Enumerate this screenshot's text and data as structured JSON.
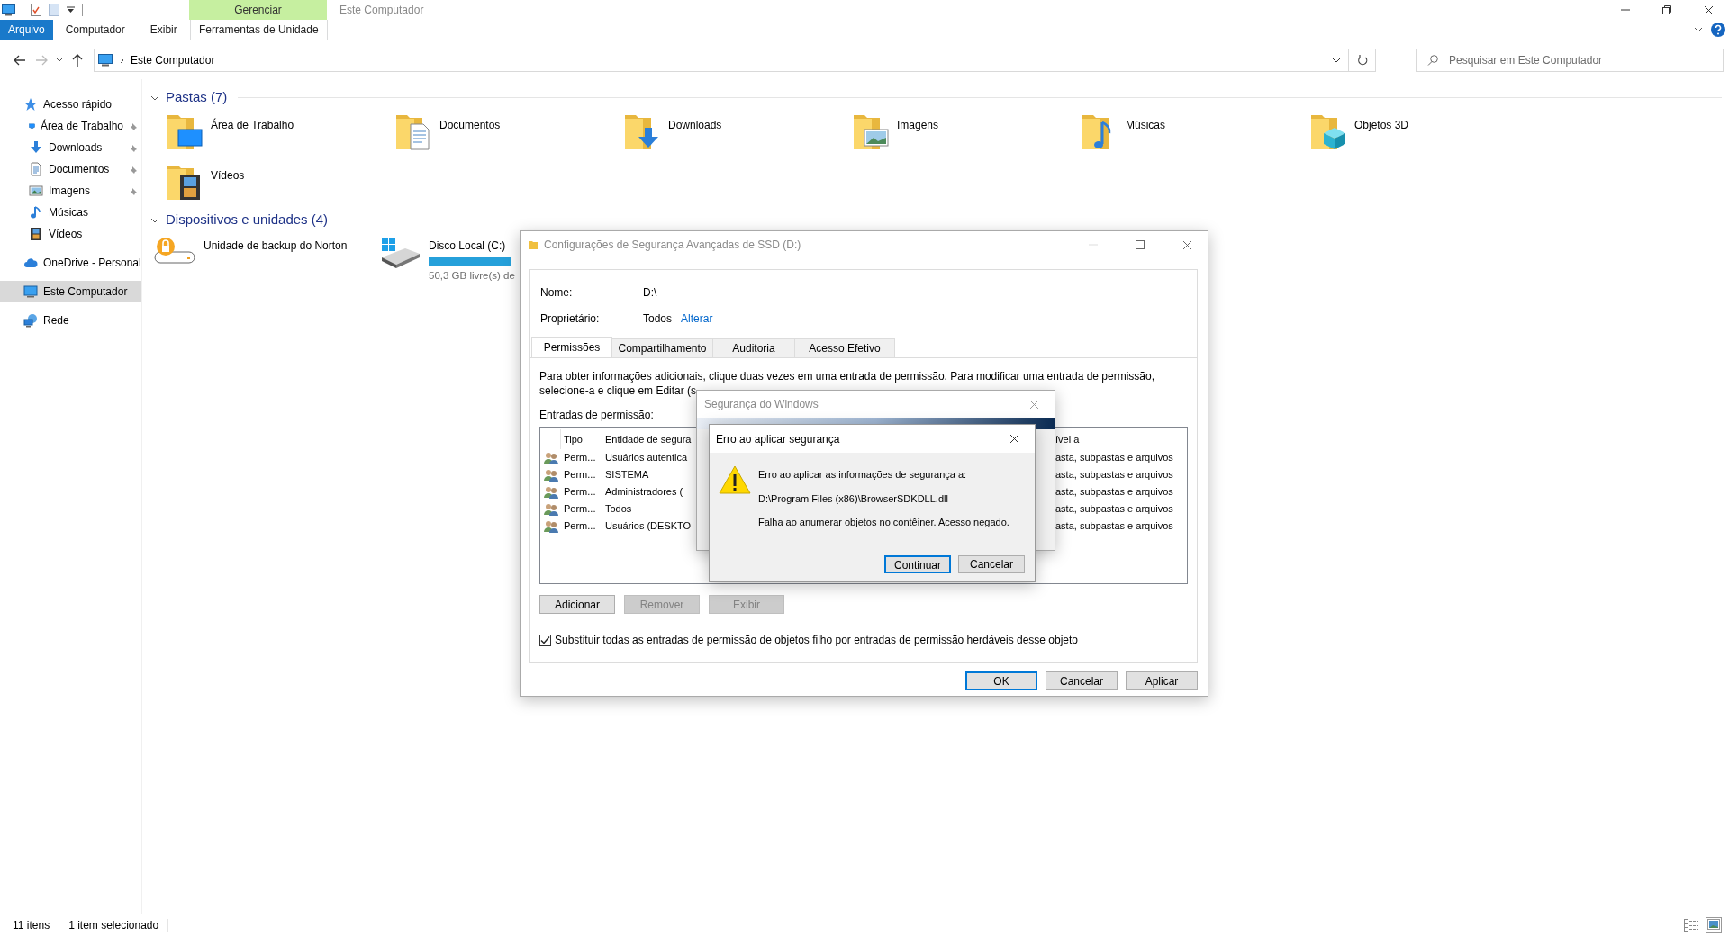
{
  "window": {
    "title": "Este Computador",
    "context_tab": "Gerenciar"
  },
  "ribbon": {
    "tabs": [
      {
        "label": "Arquivo",
        "kind": "file"
      },
      {
        "label": "Computador",
        "kind": "tab"
      },
      {
        "label": "Exibir",
        "kind": "tab"
      },
      {
        "label": "Ferramentas de Unidade",
        "kind": "context"
      }
    ]
  },
  "address_bar": {
    "path": "Este Computador"
  },
  "search": {
    "placeholder": "Pesquisar em Este Computador"
  },
  "sidebar": {
    "items": [
      {
        "label": "Acesso rápido",
        "kind": "star",
        "selected": false,
        "children": [
          {
            "label": "Área de Trabalho",
            "kind": "desktop",
            "selected": false,
            "pinned": true
          },
          {
            "label": "Downloads",
            "kind": "download",
            "selected": false,
            "pinned": true
          },
          {
            "label": "Documentos",
            "kind": "document",
            "selected": false,
            "pinned": true
          },
          {
            "label": "Imagens",
            "kind": "image",
            "selected": false,
            "pinned": true
          },
          {
            "label": "Músicas",
            "kind": "music",
            "selected": false,
            "pinned": false
          },
          {
            "label": "Vídeos",
            "kind": "video",
            "selected": false,
            "pinned": false
          }
        ]
      },
      {
        "label": "OneDrive - Personal",
        "kind": "cloud",
        "selected": false
      },
      {
        "label": "Este Computador",
        "kind": "computer",
        "selected": true
      },
      {
        "label": "Rede",
        "kind": "network",
        "selected": false
      }
    ]
  },
  "sections": [
    {
      "title": "Pastas (7)",
      "expanded": true,
      "items": [
        {
          "label": "Área de Trabalho",
          "kind": "desktop"
        },
        {
          "label": "Documentos",
          "kind": "document"
        },
        {
          "label": "Downloads",
          "kind": "download"
        },
        {
          "label": "Imagens",
          "kind": "image"
        },
        {
          "label": "Músicas",
          "kind": "music"
        },
        {
          "label": "Objetos 3D",
          "kind": "objects"
        },
        {
          "label": "Vídeos",
          "kind": "video"
        }
      ]
    },
    {
      "title": "Dispositivos e unidades (4)",
      "expanded": true,
      "items": [
        {
          "label": "Unidade de backup do Norton",
          "kind": "backup"
        },
        {
          "label": "Disco Local (C:)",
          "kind": "disk",
          "level": 1,
          "detail": "50,3 GB livre(s) de"
        }
      ]
    }
  ],
  "status_bar": {
    "item_count": "11 itens",
    "selection": "1 item selecionado",
    "views": [
      {
        "kind": "details",
        "selected": false
      },
      {
        "kind": "tiles",
        "selected": true
      }
    ]
  },
  "advanced_dialog": {
    "title": "Configurações de Segurança Avançadas de SSD (D:)",
    "name_label": "Nome:",
    "name_value": "D:\\",
    "owner_label": "Proprietário:",
    "owner_value": "Todos",
    "owner_link": "Alterar",
    "tabs": [
      {
        "label": "Permissões",
        "selected": true
      },
      {
        "label": "Compartilhamento",
        "selected": false
      },
      {
        "label": "Auditoria",
        "selected": false
      },
      {
        "label": "Acesso Efetivo",
        "selected": false
      }
    ],
    "info": [
      "Para obter informações adicionais, clique duas vezes em uma entrada de permissão. Para modificar uma entrada de permissão,",
      "selecione-a e clique em Editar (s"
    ],
    "entries_label": "Entradas de permissão:",
    "columns": [
      "Tipo",
      "Entidade de segura",
      "ível a"
    ],
    "rows": [
      {
        "type": "Perm...",
        "principal": "Usuários autentica",
        "applies_to": "asta, subpastas e arquivos"
      },
      {
        "type": "Perm...",
        "principal": "SISTEMA",
        "applies_to": "asta, subpastas e arquivos"
      },
      {
        "type": "Perm...",
        "principal": "Administradores (",
        "applies_to": "asta, subpastas e arquivos"
      },
      {
        "type": "Perm...",
        "principal": "Todos",
        "applies_to": "asta, subpastas e arquivos"
      },
      {
        "type": "Perm...",
        "principal": "Usuários (DESKTO",
        "applies_to": "asta, subpastas e arquivos"
      }
    ],
    "buttons": [
      {
        "label": "Adicionar",
        "disabled": false
      },
      {
        "label": "Remover",
        "disabled": true
      },
      {
        "label": "Exibir",
        "disabled": true
      }
    ],
    "replace_checkbox": {
      "label": "Substituir todas as entradas de permissão de objetos filho por entradas de permissão herdáveis desse objeto",
      "checked": true
    },
    "footer_buttons": [
      {
        "label": "OK",
        "default": true
      },
      {
        "label": "Cancelar",
        "default": false
      },
      {
        "label": "Aplicar",
        "default": false
      }
    ]
  },
  "security_dialog": {
    "title": "Segurança do Windows"
  },
  "error_dialog": {
    "title": "Erro ao aplicar segurança",
    "lines": [
      "Erro ao aplicar as informações de segurança a:",
      "D:\\Program Files (x86)\\BrowserSDKDLL.dll",
      "Falha ao anumerar objetos no contêiner. Acesso negado."
    ],
    "buttons": [
      {
        "label": "Continuar",
        "default": true
      },
      {
        "label": "Cancelar",
        "default": false
      }
    ]
  }
}
